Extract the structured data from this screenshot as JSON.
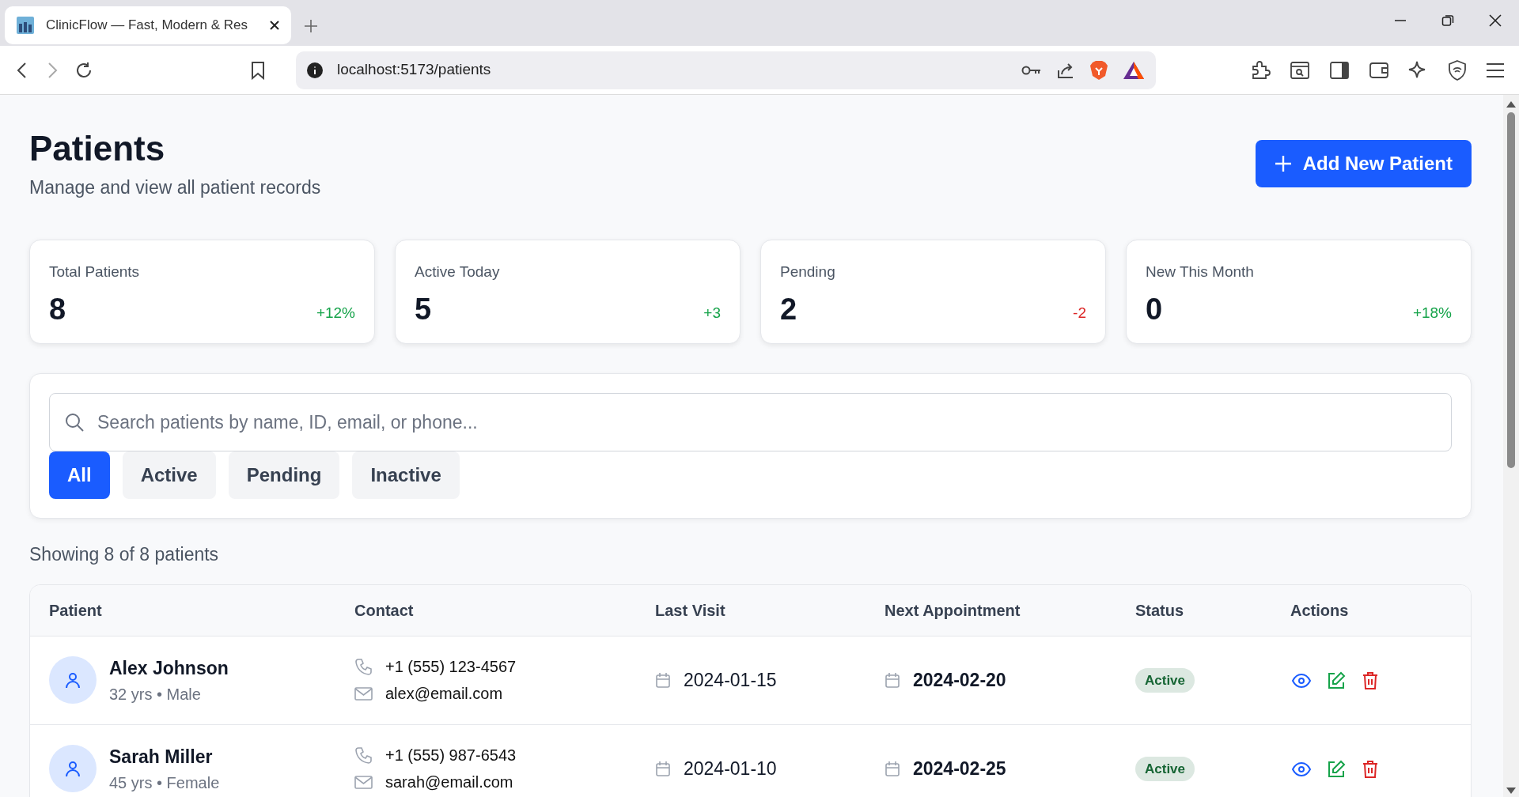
{
  "browser": {
    "tab_title": "ClinicFlow — Fast, Modern & Res",
    "url": "localhost:5173/patients"
  },
  "header": {
    "title": "Patients",
    "subtitle": "Manage and view all patient records",
    "add_button": "Add New Patient"
  },
  "stats": [
    {
      "label": "Total Patients",
      "value": "8",
      "change": "+12%",
      "color": "#16a34a"
    },
    {
      "label": "Active Today",
      "value": "5",
      "change": "+3",
      "color": "#16a34a"
    },
    {
      "label": "Pending",
      "value": "2",
      "change": "-2",
      "color": "#dc2626"
    },
    {
      "label": "New This Month",
      "value": "0",
      "change": "+18%",
      "color": "#16a34a"
    }
  ],
  "search": {
    "placeholder": "Search patients by name, ID, email, or phone..."
  },
  "filters": [
    {
      "label": "All",
      "selected": true
    },
    {
      "label": "Active",
      "selected": false
    },
    {
      "label": "Pending",
      "selected": false
    },
    {
      "label": "Inactive",
      "selected": false
    }
  ],
  "summary": "Showing 8 of 8 patients",
  "table": {
    "columns": [
      "Patient",
      "Contact",
      "Last Visit",
      "Next Appointment",
      "Status",
      "Actions"
    ],
    "rows": [
      {
        "name": "Alex Johnson",
        "details": "32 yrs • Male",
        "phone": "+1 (555) 123-4567",
        "email": "alex@email.com",
        "last_visit": "2024-01-15",
        "next_appointment": "2024-02-20",
        "status": "Active",
        "color": "#166534"
      },
      {
        "name": "Sarah Miller",
        "details": "45 yrs • Female",
        "phone": "+1 (555) 987-6543",
        "email": "sarah@email.com",
        "last_visit": "2024-01-10",
        "next_appointment": "2024-02-25",
        "status": "Active",
        "color": "#166534"
      }
    ]
  }
}
